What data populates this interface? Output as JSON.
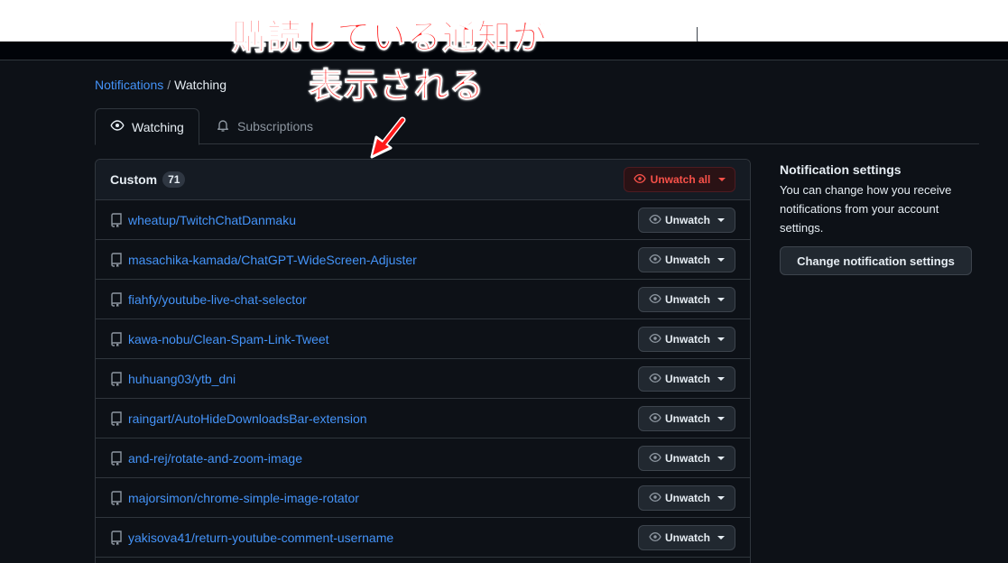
{
  "annotation": {
    "line1": "購読している通知が",
    "line2": "表示される"
  },
  "breadcrumb": {
    "parent": "Notifications",
    "separator": "/",
    "current": "Watching"
  },
  "tabs": [
    {
      "label": "Watching",
      "icon": "eye-icon",
      "active": true
    },
    {
      "label": "Subscriptions",
      "icon": "bell-icon",
      "active": false
    }
  ],
  "list": {
    "title": "Custom",
    "count": "71",
    "unwatch_all_label": "Unwatch all",
    "button_label": "Unwatch",
    "repos": [
      "wheatup/TwitchChatDanmaku",
      "masachika-kamada/ChatGPT-WideScreen-Adjuster",
      "fiahfy/youtube-live-chat-selector",
      "kawa-nobu/Clean-Spam-Link-Tweet",
      "huhuang03/ytb_dni",
      "raingart/AutoHideDownloadsBar-extension",
      "and-rej/rotate-and-zoom-image",
      "majorsimon/chrome-simple-image-rotator",
      "yakisova41/return-youtube-comment-username"
    ]
  },
  "sidebar": {
    "title": "Notification settings",
    "description": "You can change how you receive notifications from your account settings.",
    "button_label": "Change notification settings"
  },
  "colors": {
    "background": "#0d1117",
    "link": "#4493f8",
    "danger": "#f85149",
    "annotation": "#ff1a1a"
  }
}
